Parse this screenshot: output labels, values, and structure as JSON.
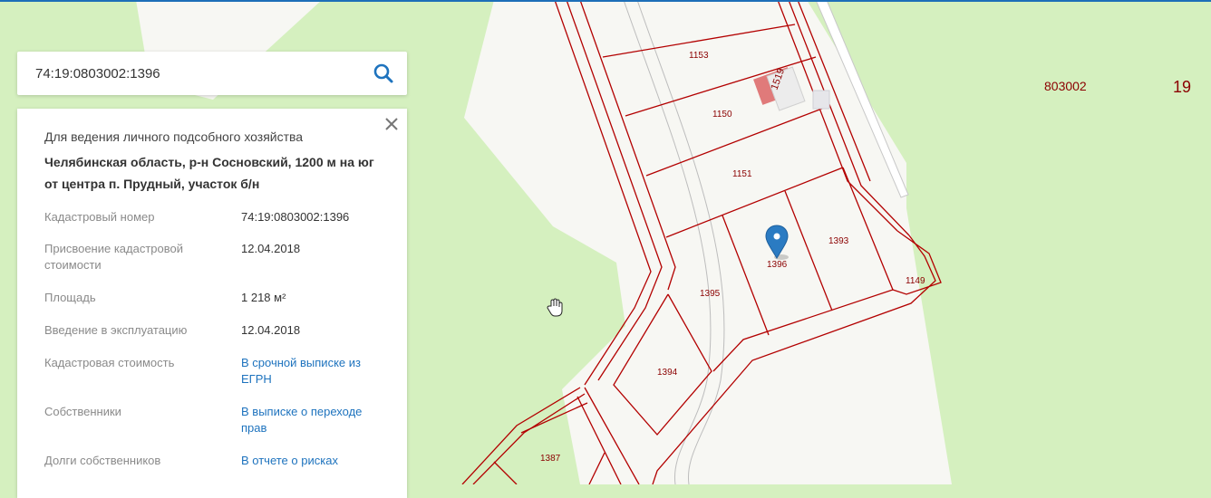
{
  "search": {
    "value": "74:19:0803002:1396"
  },
  "map": {
    "quarter_label": "803002",
    "district_label": "19",
    "parcels": [
      "1153",
      "1150",
      "1151",
      "1393",
      "1396",
      "1395",
      "1394",
      "1149",
      "1387"
    ],
    "building_label": "1519"
  },
  "card": {
    "purpose": "Для ведения личного подсобного хозяйства",
    "address": "Челябинская область, р-н Сосновский, 1200 м на юг от центра п. Прудный, участок б/н",
    "rows": [
      {
        "label": "Кадастровый номер",
        "value": "74:19:0803002:1396"
      },
      {
        "label": "Присвоение кадастровой стоимости",
        "value": "12.04.2018"
      },
      {
        "label": "Площадь",
        "value": "1 218 м²"
      },
      {
        "label": "Введение в эксплуатацию",
        "value": "12.04.2018"
      },
      {
        "label": "Кадастровая стоимость",
        "value": "В срочной выписке из ЕГРН"
      },
      {
        "label": "Собственники",
        "value": "В выписке о переходе прав"
      },
      {
        "label": "Долги собственников",
        "value": "В отчете о рисках"
      }
    ]
  }
}
